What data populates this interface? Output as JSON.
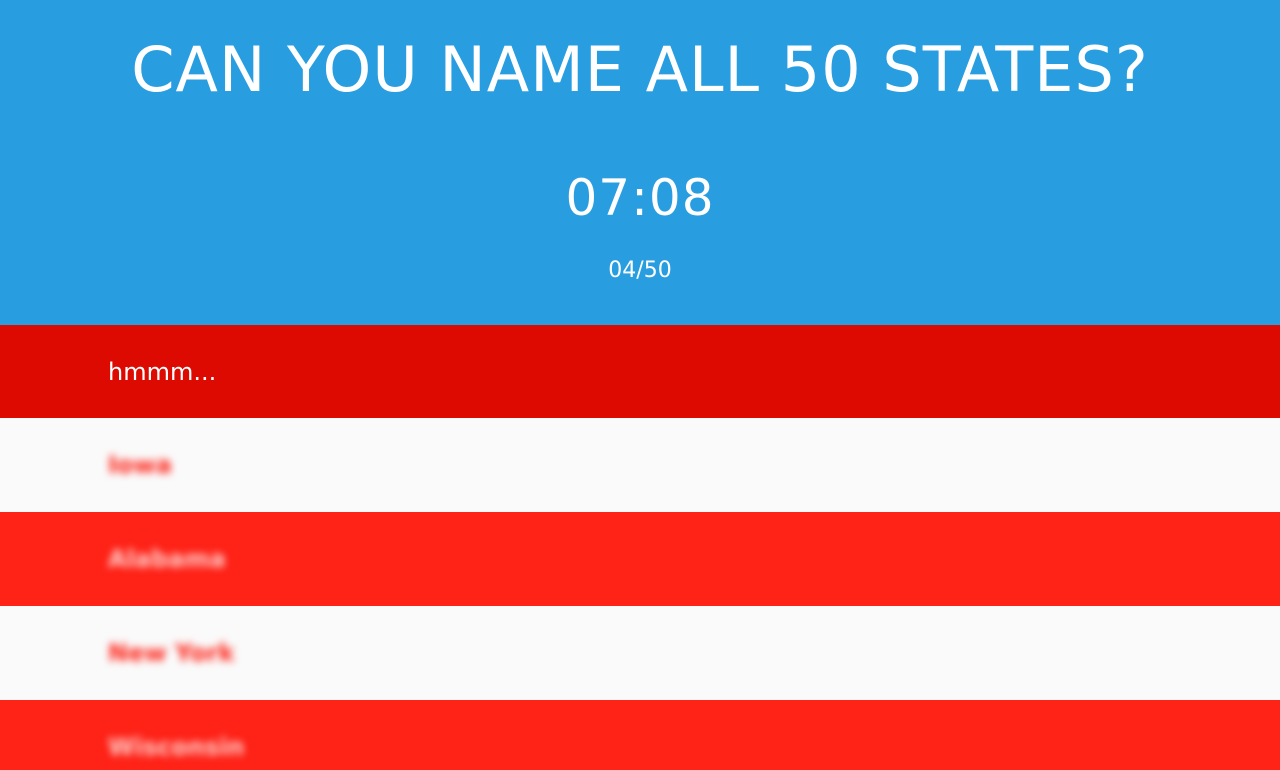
{
  "header": {
    "title": "CAN YOU NAME ALL 50 STATES?",
    "timer": "07:08",
    "counter": "04/50"
  },
  "input": {
    "placeholder": "hmmm...",
    "value": ""
  },
  "answers": [
    "Iowa",
    "Alabama",
    "New York",
    "Wisconsin"
  ],
  "colors": {
    "header_bg": "#289ee0",
    "input_bg": "#dc0a00",
    "stripe_red": "#fe2217",
    "stripe_white": "#fafafa"
  }
}
